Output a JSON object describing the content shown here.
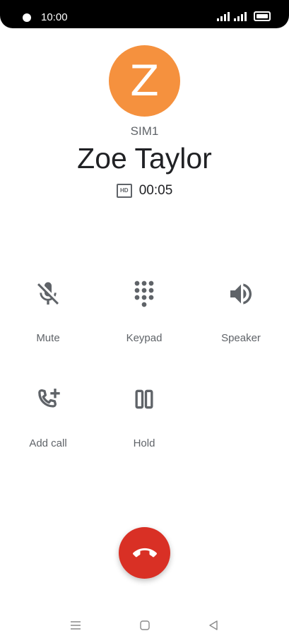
{
  "status_bar": {
    "time": "10:00"
  },
  "contact": {
    "initial": "Z",
    "avatar_color": "#f5913e",
    "sim": "SIM1",
    "name": "Zoe Taylor"
  },
  "call": {
    "quality_badge": "HD",
    "duration": "00:05"
  },
  "actions": {
    "mute": {
      "label": "Mute",
      "icon": "mic-off-icon"
    },
    "keypad": {
      "label": "Keypad",
      "icon": "dialpad-icon"
    },
    "speaker": {
      "label": "Speaker",
      "icon": "volume-icon"
    },
    "add_call": {
      "label": "Add call",
      "icon": "add-call-icon"
    },
    "hold": {
      "label": "Hold",
      "icon": "pause-icon"
    }
  },
  "end_call": {
    "icon": "call-end-icon",
    "color": "#d93025"
  },
  "nav": {
    "menu": "menu-icon",
    "home": "home-icon",
    "back": "back-icon"
  }
}
